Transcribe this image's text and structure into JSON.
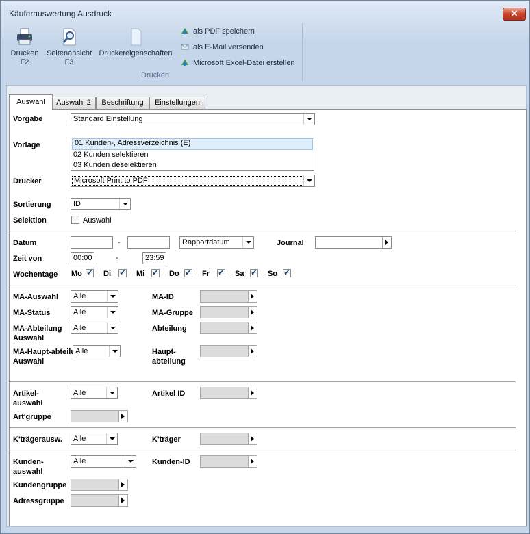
{
  "window": {
    "title": "Käuferauswertung Ausdruck",
    "close_glyph": "✕"
  },
  "ribbon": {
    "print_label": "Drucken",
    "print_key": "F2",
    "preview_label": "Seitenansicht",
    "preview_key": "F3",
    "printer_props_label": "Druckereigenschaften",
    "pdf_label": "als PDF speichern",
    "email_label": "als E-Mail versenden",
    "excel_label": "Microsoft Excel-Datei erstellen",
    "group_label": "Drucken",
    "icons": [
      "printer-icon",
      "magnifier-icon",
      "document-icon",
      "pdf-icon",
      "email-icon",
      "excel-icon"
    ]
  },
  "tabs": [
    "Auswahl",
    "Auswahl 2",
    "Beschriftung",
    "Einstellungen"
  ],
  "form": {
    "vorgabe_label": "Vorgabe",
    "vorgabe_value": "Standard Einstellung",
    "vorlage_label": "Vorlage",
    "vorlage_items": [
      "01 Kunden-, Adressverzeichnis (E)",
      "02 Kunden selektieren",
      "03 Kunden deselektieren"
    ],
    "drucker_label": "Drucker",
    "drucker_value": "Microsoft Print to PDF",
    "sortierung_label": "Sortierung",
    "sortierung_value": "ID",
    "selektion_label": "Selektion",
    "selektion_check_label": "Auswahl",
    "datum_label": "Datum",
    "datum_from": "",
    "datum_dash": "-",
    "datum_to": "",
    "datum_type": "Rapportdatum",
    "journal_label": "Journal",
    "journal_value": "",
    "zeit_label": "Zeit von",
    "zeit_from": "00:00",
    "zeit_dash": "-",
    "zeit_to": "23:59",
    "wochentage_label": "Wochentage",
    "days": [
      "Mo",
      "Di",
      "Mi",
      "Do",
      "Fr",
      "Sa",
      "So"
    ],
    "ma_auswahl_label": "MA-Auswahl",
    "ma_auswahl_value": "Alle",
    "ma_id_label": "MA-ID",
    "ma_status_label": "MA-Status",
    "ma_status_value": "Alle",
    "ma_gruppe_label": "MA-Gruppe",
    "ma_abteilung_label": "MA-Abteilung Auswahl",
    "ma_abteilung_value": "Alle",
    "abteilung_label": "Abteilung",
    "ma_haupt_label": "MA-Haupt-abteilung Auswahl",
    "ma_haupt_value": "Alle",
    "hauptabteilung_label": "Haupt-abteilung",
    "artikel_label": "Artikel-auswahl",
    "artikel_value": "Alle",
    "artikel_id_label": "Artikel ID",
    "artgruppe_label": "Art'gruppe",
    "ktraeger_ausw_label": "K'trägerausw.",
    "ktraeger_ausw_value": "Alle",
    "ktraeger_label": "K'träger",
    "kunden_label": "Kunden-auswahl",
    "kunden_value": "Alle",
    "kunden_id_label": "Kunden-ID",
    "kundengruppe_label": "Kundengruppe",
    "adressgruppe_label": "Adressgruppe"
  }
}
